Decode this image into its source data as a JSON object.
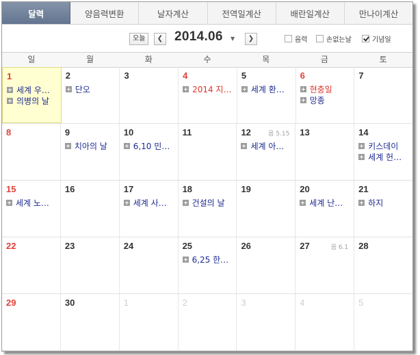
{
  "tabs": [
    {
      "label": "달력",
      "active": true
    },
    {
      "label": "양음력변환",
      "active": false
    },
    {
      "label": "날자계산",
      "active": false
    },
    {
      "label": "전역일계산",
      "active": false
    },
    {
      "label": "배란일계산",
      "active": false
    },
    {
      "label": "만나이계산",
      "active": false
    }
  ],
  "toolbar": {
    "today_label": "오늘",
    "prev_glyph": "❮",
    "next_glyph": "❯",
    "month": "2014.06",
    "month_caret": "▼",
    "options": {
      "lunar": {
        "label": "음력",
        "checked": false
      },
      "noloss": {
        "label": "손없는날",
        "checked": false
      },
      "memorial": {
        "label": "기념일",
        "checked": true
      }
    }
  },
  "weekdays": [
    "일",
    "월",
    "화",
    "수",
    "목",
    "금",
    "토"
  ],
  "colors": {
    "sunday": "#e0403a",
    "event": "#1d2a8f",
    "event_holiday": "#d9352d",
    "today_bg": "#ffffd1",
    "tab_active": "#6f7f97"
  },
  "weeks": [
    [
      {
        "day": "1",
        "sun": true,
        "today": true,
        "events": [
          {
            "text": "세계 우…"
          },
          {
            "text": "의병의 날"
          }
        ]
      },
      {
        "day": "2",
        "events": [
          {
            "text": "단오"
          }
        ]
      },
      {
        "day": "3",
        "events": []
      },
      {
        "day": "4",
        "sun": true,
        "events": [
          {
            "text": "2014 지…",
            "red": true
          }
        ]
      },
      {
        "day": "5",
        "events": [
          {
            "text": "세계 환…"
          }
        ]
      },
      {
        "day": "6",
        "sun": true,
        "events": [
          {
            "text": "현충일",
            "red": true
          },
          {
            "text": "망종"
          }
        ]
      },
      {
        "day": "7",
        "events": []
      }
    ],
    [
      {
        "day": "8",
        "sun": true,
        "events": []
      },
      {
        "day": "9",
        "events": [
          {
            "text": "치아의 날"
          }
        ]
      },
      {
        "day": "10",
        "events": [
          {
            "text": "6,10 민…"
          }
        ]
      },
      {
        "day": "11",
        "events": []
      },
      {
        "day": "12",
        "lunar": "음 5.15",
        "events": [
          {
            "text": "세계 아…"
          }
        ]
      },
      {
        "day": "13",
        "events": []
      },
      {
        "day": "14",
        "events": [
          {
            "text": "키스데이"
          },
          {
            "text": "세계 헌…"
          }
        ]
      }
    ],
    [
      {
        "day": "15",
        "sun": true,
        "events": [
          {
            "text": "세계 노…"
          }
        ]
      },
      {
        "day": "16",
        "events": []
      },
      {
        "day": "17",
        "events": [
          {
            "text": "세계 사…"
          }
        ]
      },
      {
        "day": "18",
        "events": [
          {
            "text": "건설의 날"
          }
        ]
      },
      {
        "day": "19",
        "events": []
      },
      {
        "day": "20",
        "events": [
          {
            "text": "세계 난…"
          }
        ]
      },
      {
        "day": "21",
        "events": [
          {
            "text": "하지"
          }
        ]
      }
    ],
    [
      {
        "day": "22",
        "sun": true,
        "events": []
      },
      {
        "day": "23",
        "events": []
      },
      {
        "day": "24",
        "events": []
      },
      {
        "day": "25",
        "events": [
          {
            "text": "6,25 한…"
          }
        ]
      },
      {
        "day": "26",
        "events": []
      },
      {
        "day": "27",
        "lunar": "음 6.1",
        "events": []
      },
      {
        "day": "28",
        "events": []
      }
    ],
    [
      {
        "day": "29",
        "sun": true,
        "events": []
      },
      {
        "day": "30",
        "events": []
      },
      {
        "day": "1",
        "other": true,
        "events": []
      },
      {
        "day": "2",
        "other": true,
        "events": []
      },
      {
        "day": "3",
        "other": true,
        "events": []
      },
      {
        "day": "4",
        "other": true,
        "events": []
      },
      {
        "day": "5",
        "other": true,
        "events": []
      }
    ]
  ]
}
